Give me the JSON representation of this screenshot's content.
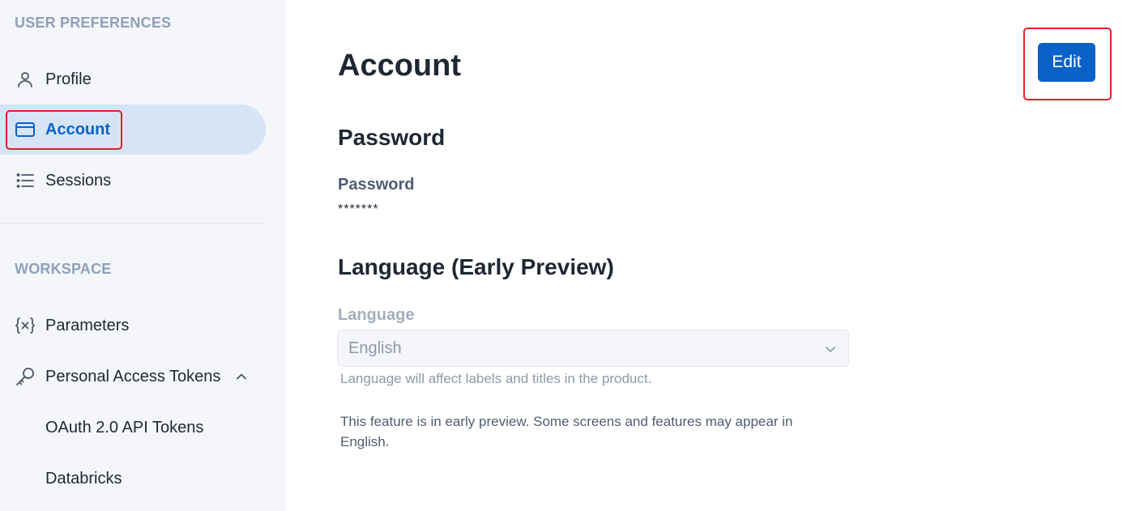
{
  "sidebar": {
    "user_preferences_title": "USER PREFERENCES",
    "workspace_title": "WORKSPACE",
    "items": [
      {
        "label": "Profile",
        "icon": "user-icon"
      },
      {
        "label": "Account",
        "icon": "card-icon",
        "active": true
      },
      {
        "label": "Sessions",
        "icon": "list-icon"
      },
      {
        "label": "Parameters",
        "icon": "variable-icon"
      },
      {
        "label": "Personal Access Tokens",
        "icon": "key-icon",
        "expanded": true
      },
      {
        "label": "OAuth 2.0 API Tokens"
      },
      {
        "label": "Databricks"
      }
    ]
  },
  "main": {
    "title": "Account",
    "edit_label": "Edit",
    "password_section": {
      "heading": "Password",
      "label": "Password",
      "value": "*******"
    },
    "language_section": {
      "heading": "Language (Early Preview)",
      "label": "Language",
      "selected": "English",
      "helper": "Language will affect labels and titles in the product.",
      "note": "This feature is in early preview. Some screens and features may appear in English."
    }
  },
  "colors": {
    "accent": "#0a62c9",
    "active_bg": "#d6e4f5",
    "highlight": "#e0202a"
  }
}
